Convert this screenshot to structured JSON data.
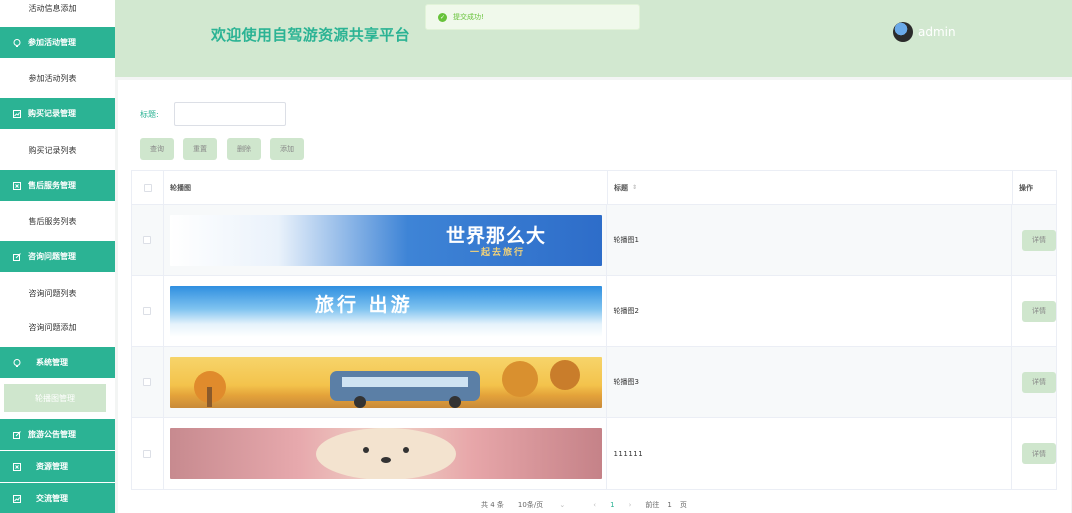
{
  "header": {
    "welcome": "欢迎使用自驾游资源共享平台",
    "toast": "提交成功!",
    "username": "admin"
  },
  "sidebar": {
    "top_item": "活动信息添加",
    "groups": [
      {
        "label": "参加活动管理",
        "icon": "bulb-icon",
        "sub": [
          "参加活动列表"
        ]
      },
      {
        "label": "购买记录管理",
        "icon": "chart-icon",
        "sub": [
          "购买记录列表"
        ]
      },
      {
        "label": "售后服务管理",
        "icon": "doc-x-icon",
        "sub": [
          "售后服务列表"
        ]
      },
      {
        "label": "咨询问题管理",
        "icon": "edit-icon",
        "sub": [
          "咨询问题列表",
          "咨询问题添加"
        ]
      },
      {
        "label": "系统管理",
        "icon": "bulb-icon",
        "sub": [
          "轮播图管理"
        ]
      },
      {
        "label": "旅游公告管理",
        "icon": "edit-icon",
        "sub": []
      },
      {
        "label": "资源管理",
        "icon": "doc-x-icon",
        "sub": []
      },
      {
        "label": "交流管理",
        "icon": "chart-icon",
        "sub": []
      }
    ]
  },
  "search": {
    "label": "标题:",
    "placeholder": "",
    "buttons": {
      "query": "查询",
      "reset": "重置",
      "delete": "删除",
      "add": "添加"
    }
  },
  "table": {
    "headers": {
      "image": "轮播图",
      "title": "标题",
      "ops": "操作"
    },
    "rows": [
      {
        "title": "轮播图1",
        "banner_text": "世界那么大",
        "banner_sub": "一起去旅行",
        "detail": "详情"
      },
      {
        "title": "轮播图2",
        "banner_text": "旅行 出游",
        "detail": "详情"
      },
      {
        "title": "轮播图3",
        "detail": "详情"
      },
      {
        "title": "111111",
        "detail": "详情"
      }
    ]
  },
  "pagination": {
    "total": "共 4 条",
    "page_size": "10条/页",
    "current": "1",
    "goto_label": "前往",
    "goto_value": "1",
    "page_unit": "页"
  },
  "colors": {
    "accent": "#2bb394",
    "header_bg": "#d2e8d0",
    "button_bg": "#cfe6cd",
    "success": "#67c23a"
  }
}
